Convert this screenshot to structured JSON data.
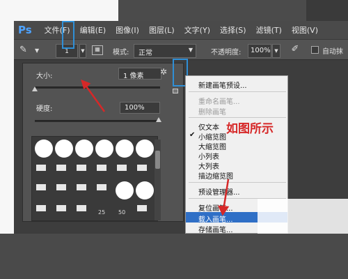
{
  "app": {
    "logo": "Ps",
    "menus": [
      "文件(F)",
      "编辑(E)",
      "图像(I)",
      "图层(L)",
      "文字(Y)",
      "选择(S)",
      "滤镜(T)",
      "视图(V)"
    ]
  },
  "options": {
    "size_value": "1",
    "mode_label": "模式:",
    "mode_value": "正常",
    "opacity_label": "不透明度:",
    "opacity_value": "100%",
    "auto_label": "自动抹"
  },
  "brush_panel": {
    "size_label": "大小:",
    "size_value": "1 像素",
    "hardness_label": "硬度:",
    "hardness_value": "100%",
    "preset_numbers": [
      "25",
      "50"
    ]
  },
  "context_menu": {
    "items": [
      {
        "label": "新建画笔预设...",
        "disabled": false,
        "checked": false
      },
      {
        "label": "重命名画笔...",
        "disabled": true,
        "checked": false
      },
      {
        "label": "删除画笔",
        "disabled": true,
        "checked": false
      },
      {
        "label": "仅文本",
        "disabled": false,
        "checked": false
      },
      {
        "label": "小缩览图",
        "disabled": false,
        "checked": true
      },
      {
        "label": "大缩览图",
        "disabled": false,
        "checked": false
      },
      {
        "label": "小列表",
        "disabled": false,
        "checked": false
      },
      {
        "label": "大列表",
        "disabled": false,
        "checked": false
      },
      {
        "label": "描边缩览图",
        "disabled": false,
        "checked": false
      },
      {
        "label": "预设管理器...",
        "disabled": false,
        "checked": false
      },
      {
        "label": "复位画笔...",
        "disabled": false,
        "checked": false
      },
      {
        "label": "载入画笔...",
        "disabled": false,
        "checked": false
      },
      {
        "label": "存储画笔...",
        "disabled": false,
        "checked": false
      }
    ],
    "highlighted_index": 11
  },
  "annotation": "如图所示",
  "colors": {
    "highlight_box": "#2f8fd6",
    "annotation_red": "#d62828",
    "menu_selection": "#2f6fc6"
  }
}
